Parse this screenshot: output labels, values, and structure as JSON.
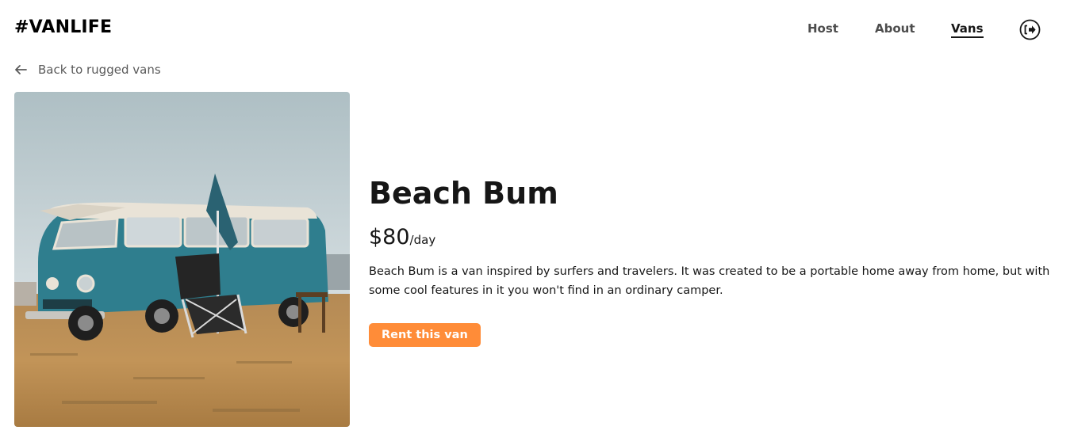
{
  "header": {
    "logo": "#VANLIFE",
    "nav": [
      {
        "label": "Host"
      },
      {
        "label": "About"
      },
      {
        "label": "Vans",
        "active": true
      }
    ],
    "logout_icon": "logout-icon"
  },
  "back_link": {
    "label": "Back to rugged vans",
    "icon": "arrow-left-icon"
  },
  "van": {
    "name": "Beach Bum",
    "price": "$80",
    "price_unit": "/day",
    "description": "Beach Bum is a van inspired by surfers and travelers. It was created to be a portable home away from home, but with some cool features in it you won't find in an ordinary camper.",
    "cta_label": "Rent this van",
    "accent_color": "#ff8c38"
  }
}
